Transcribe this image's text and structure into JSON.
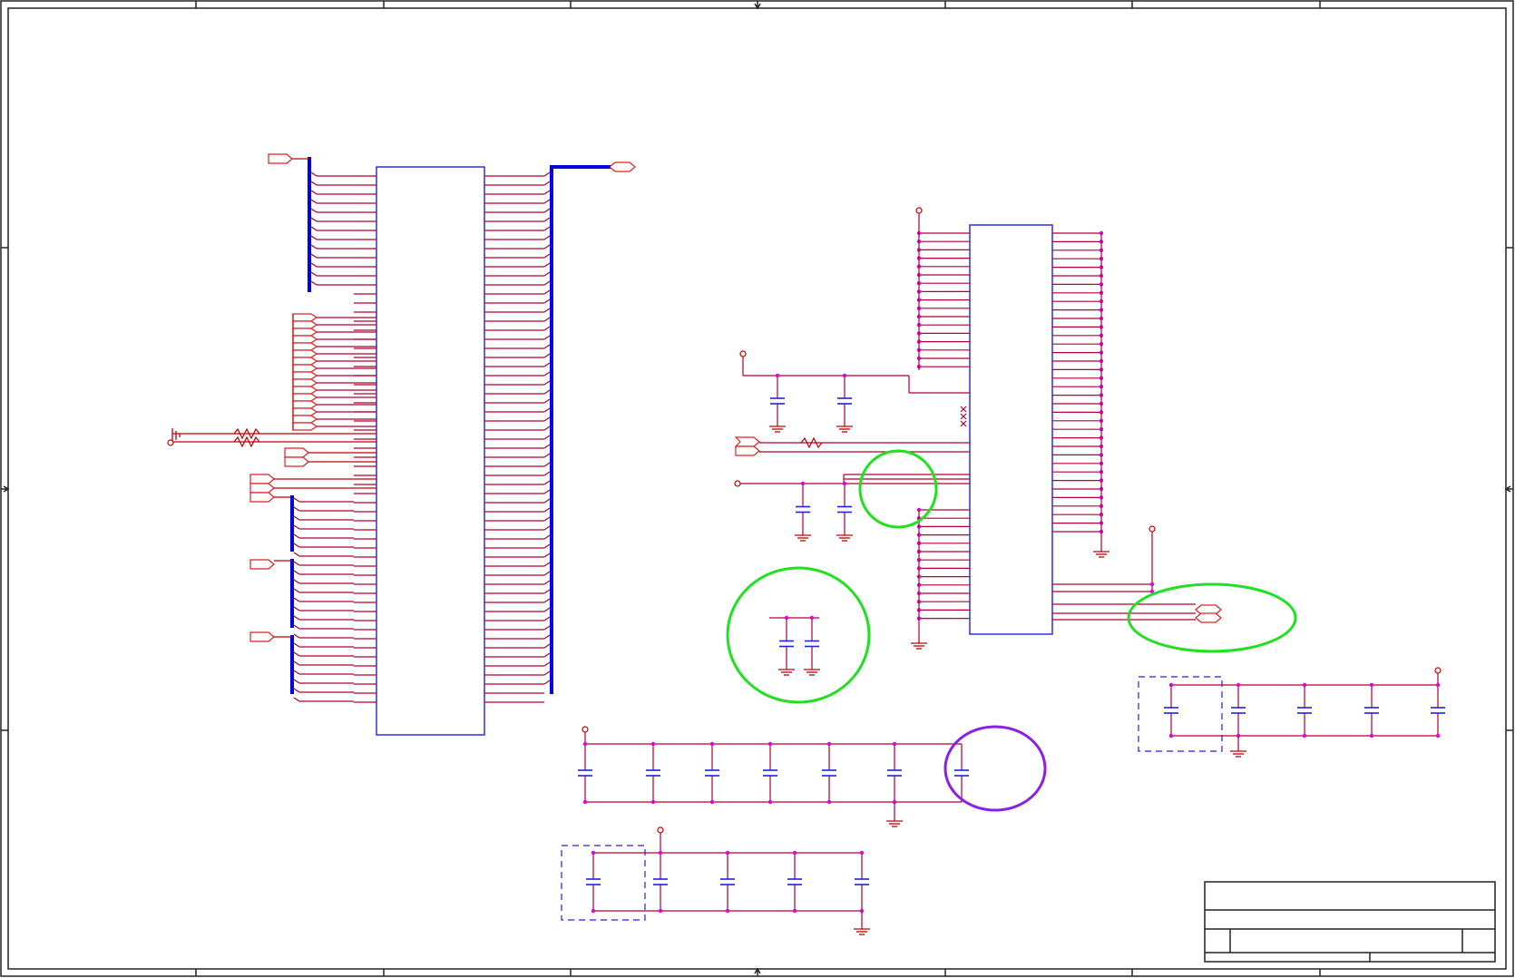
{
  "sheet": {
    "title_block": {
      "title": "",
      "size": "",
      "document_number": "",
      "revision": "",
      "date": "",
      "sheet": ""
    }
  },
  "colors": {
    "wire": "#c00000",
    "bus": "#0000e0",
    "component": "#2020e0",
    "junction": "#e000e0",
    "highlight_green": "#20e020",
    "highlight_purple": "#8a20e8"
  }
}
